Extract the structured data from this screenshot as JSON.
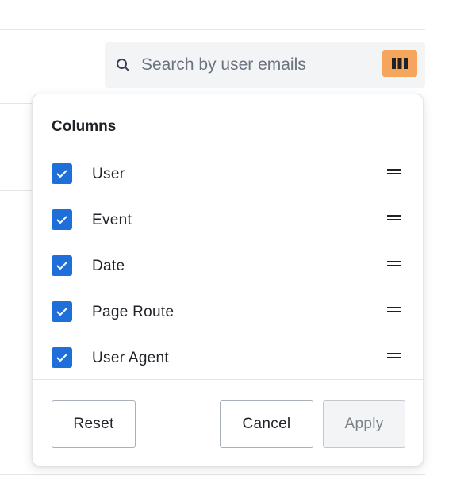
{
  "search": {
    "placeholder": "Search by user emails",
    "icon": "search-icon"
  },
  "toolbar": {
    "columns_button_icon": "columns-icon",
    "columns_button_color": "#f5a55c"
  },
  "columns_popover": {
    "title": "Columns",
    "accent_color": "#1e6fd9",
    "items": [
      {
        "label": "User",
        "checked": true
      },
      {
        "label": "Event",
        "checked": true
      },
      {
        "label": "Date",
        "checked": true
      },
      {
        "label": "Page Route",
        "checked": true
      },
      {
        "label": "User Agent",
        "checked": true
      }
    ],
    "buttons": {
      "reset": "Reset",
      "cancel": "Cancel",
      "apply": "Apply"
    }
  }
}
